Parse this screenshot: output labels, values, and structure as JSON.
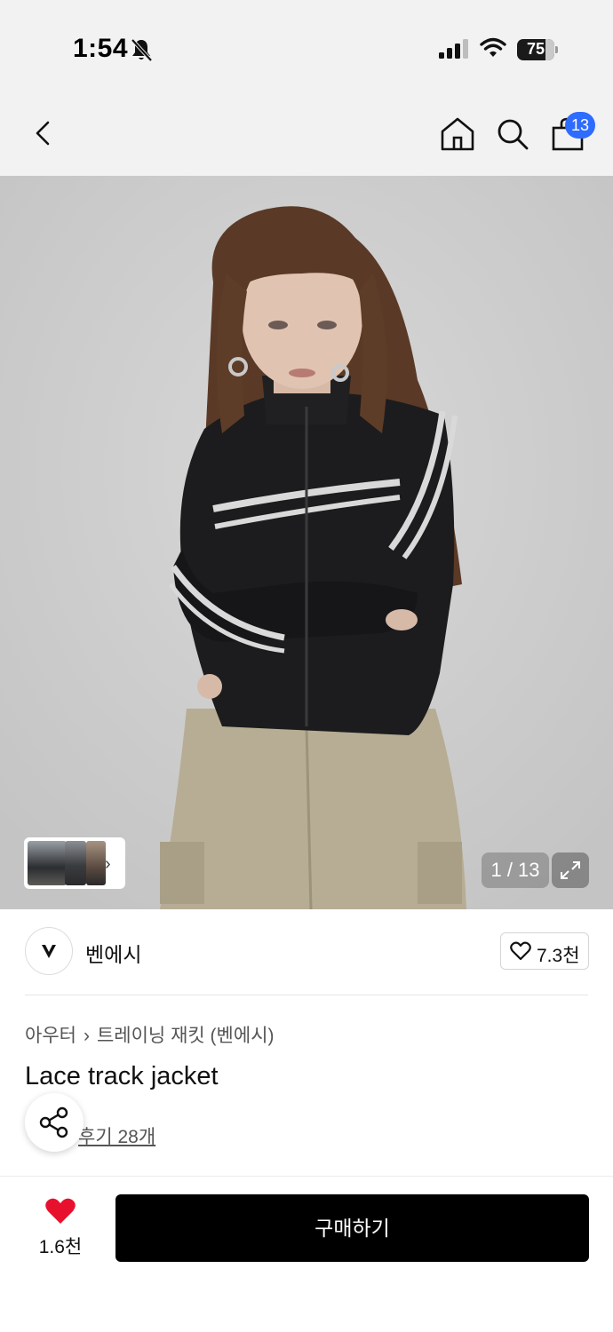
{
  "status_bar": {
    "time": "1:54",
    "battery": "75",
    "battery_level": 0.75,
    "icons": [
      "bell-slash-icon",
      "signal-icon",
      "wifi-icon",
      "battery-icon"
    ]
  },
  "header": {
    "icons": [
      "back-icon",
      "home-icon",
      "search-icon",
      "bag-icon"
    ],
    "cart_badge": "13",
    "accent_color": "#2e6bff"
  },
  "gallery": {
    "counter": "1 / 13",
    "thumbnail_more_icon": "chevron-right-icon",
    "expand_icon": "expand-icon",
    "image_description_colors": [
      "#cfcfcf",
      "#1c1c1e",
      "#b9ae96"
    ]
  },
  "brand": {
    "name": "벤에시",
    "logo_icon": "brand-v-logo",
    "likes": "7.3천",
    "like_icon": "heart-outline-icon"
  },
  "product": {
    "breadcrumb": [
      "아우터",
      "트레이닝 재킷 (벤에시)"
    ],
    "name": "Lace track jacket",
    "reviews_text": "후기 28개",
    "share_icon": "share-icon"
  },
  "bottom_bar": {
    "wish_count": "1.6천",
    "wish_icon": "heart-filled-icon",
    "wish_color": "#e8112d",
    "buy_label": "구매하기"
  }
}
